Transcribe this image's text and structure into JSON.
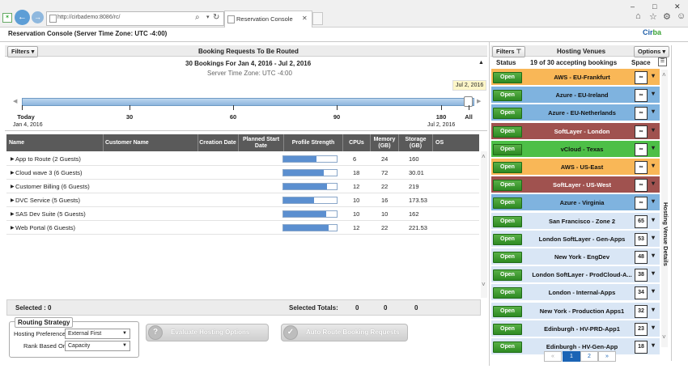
{
  "browser": {
    "url": "http://cirbademo:8086/rc/",
    "tab_title": "Reservation Console",
    "tab_close": "✕",
    "back": "←",
    "forward": "→",
    "search_glyph": "⌕",
    "refresh_glyph": "↻",
    "window_controls": [
      "–",
      "□",
      "✕"
    ],
    "toolbar_glyphs": [
      "⌂",
      "☆",
      "⚙",
      "☺"
    ]
  },
  "app": {
    "title": "Reservation Console (Server Time Zone: UTC -4:00)",
    "logo_a": "Cir",
    "logo_b": "ba"
  },
  "booking": {
    "filters_label": "Filters ▾",
    "panel_title": "Booking Requests To Be Routed",
    "range_title": "30 Bookings For Jan 4, 2016 - Jul 2, 2016",
    "server_tz": "Server Time Zone: UTC -4:00",
    "collapse_glyph": "▲",
    "timeline": {
      "marker_label": "Jul 2, 2016",
      "ticks": [
        "Today",
        "30",
        "60",
        "90",
        "180",
        "All"
      ],
      "start_date": "Jan 4, 2016",
      "end_date": "Jul 2, 2016",
      "arrow_left": "◀",
      "arrow_right": "▶"
    },
    "columns": [
      "Name",
      "Customer Name",
      "Creation Date",
      "Planned Start Date",
      "Profile Strength",
      "CPUs",
      "Memory (GB)",
      "Storage (GB)",
      "OS"
    ],
    "rows": [
      {
        "name": "App to Route (2 Guests)",
        "cpus": "6",
        "memory": "24",
        "storage": "160",
        "strength": 0.62
      },
      {
        "name": "Cloud wave 3 (6 Guests)",
        "cpus": "18",
        "memory": "72",
        "storage": "30.01",
        "strength": 0.75
      },
      {
        "name": "Customer Billing (6 Guests)",
        "cpus": "12",
        "memory": "22",
        "storage": "219",
        "strength": 0.82
      },
      {
        "name": "DVC Service (5 Guests)",
        "cpus": "10",
        "memory": "16",
        "storage": "173.53",
        "strength": 0.58
      },
      {
        "name": "SAS Dev Suite (5 Guests)",
        "cpus": "10",
        "memory": "10",
        "storage": "162",
        "strength": 0.8
      },
      {
        "name": "Web Portal (6 Guests)",
        "cpus": "12",
        "memory": "22",
        "storage": "221.53",
        "strength": 0.85
      }
    ],
    "selected_label": "Selected : 0",
    "selected_totals_label": "Selected Totals:",
    "totals": [
      "0",
      "0",
      "0"
    ]
  },
  "routing": {
    "legend": "Routing Strategy",
    "hosting_pref_label": "Hosting Preference:",
    "hosting_pref_value": "External First",
    "rank_label": "Rank Based On:",
    "rank_value": "Capacity",
    "evaluate_label": "Evaluate Hosting Options",
    "auto_route_label": "Auto Route Booking Requests"
  },
  "venues": {
    "filters_label": "Filters",
    "title": "Hosting Venues",
    "options_label": "Options ▾",
    "status_header": "Status",
    "accepting": "19 of 30 accepting bookings",
    "space_header": "Space",
    "open_label": "Open",
    "side_tab": "Hosting Venue Details",
    "items": [
      {
        "name": "AWS - EU-Frankfurt",
        "space": "∞",
        "color": "#f9b757"
      },
      {
        "name": "Azure - EU-Ireland",
        "space": "∞",
        "color": "#7fb3df"
      },
      {
        "name": "Azure - EU-Netherlands",
        "space": "∞",
        "color": "#7fb3df"
      },
      {
        "name": "SoftLayer - London",
        "space": "∞",
        "color": "#a0524f"
      },
      {
        "name": "vCloud - Texas",
        "space": "∞",
        "color": "#4dbf47"
      },
      {
        "name": "AWS - US-East",
        "space": "∞",
        "color": "#f9b757"
      },
      {
        "name": "SoftLayer - US-West",
        "space": "∞",
        "color": "#a0524f"
      },
      {
        "name": "Azure - Virginia",
        "space": "∞",
        "color": "#7fb3df"
      },
      {
        "name": "San Francisco - Zone 2",
        "space": "65",
        "color": "#d9e6f5"
      },
      {
        "name": "London SoftLayer - Gen-Apps",
        "space": "53",
        "color": "#d9e6f5"
      },
      {
        "name": "New York - EngDev",
        "space": "48",
        "color": "#d9e6f5"
      },
      {
        "name": "London SoftLayer - ProdCloud-A...",
        "space": "38",
        "color": "#d9e6f5"
      },
      {
        "name": "London - Internal-Apps",
        "space": "34",
        "color": "#d9e6f5"
      },
      {
        "name": "New York - Production Apps1",
        "space": "32",
        "color": "#d9e6f5"
      },
      {
        "name": "Edinburgh - HV-PRD-App1",
        "space": "23",
        "color": "#d9e6f5"
      },
      {
        "name": "Edinburgh - HV-Gen-App",
        "space": "18",
        "color": "#d9e6f5"
      }
    ],
    "pagination": {
      "prev": "«",
      "pages": [
        "1",
        "2"
      ],
      "next": "»",
      "current": "1"
    }
  }
}
